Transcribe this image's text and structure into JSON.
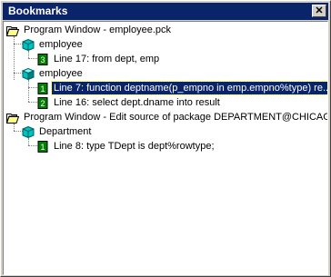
{
  "window": {
    "title": "Bookmarks",
    "close_glyph": "✕"
  },
  "tree": {
    "roots": [
      {
        "label": "Program Window - employee.pck",
        "icon": "folder-open-icon",
        "children": [
          {
            "label": "employee",
            "icon": "package-icon",
            "children": [
              {
                "label": "Line 17: from dept, emp",
                "icon": "bookmark-3-icon",
                "badge": "3"
              }
            ]
          },
          {
            "label": "employee",
            "icon": "package-body-icon",
            "children": [
              {
                "label": "Line 7: function deptname(p_empno in emp.empno%type) re...",
                "icon": "bookmark-1-icon",
                "badge": "1",
                "selected": true
              },
              {
                "label": "Line 16: select dept.dname into result",
                "icon": "bookmark-2-icon",
                "badge": "2"
              }
            ]
          }
        ]
      },
      {
        "label": "Program Window - Edit source of package DEPARTMENT@CHICAGO",
        "icon": "folder-open-icon",
        "children": [
          {
            "label": "Department",
            "icon": "package-icon",
            "children": [
              {
                "label": "Line 8: type TDept is dept%rowtype;",
                "icon": "bookmark-1-icon",
                "badge": "1"
              }
            ]
          }
        ]
      }
    ]
  },
  "colors": {
    "selection": "#0a246a",
    "titlebar": "#0a246a",
    "bookmark_green": "#008000",
    "package_cyan": "#00c0c0"
  }
}
